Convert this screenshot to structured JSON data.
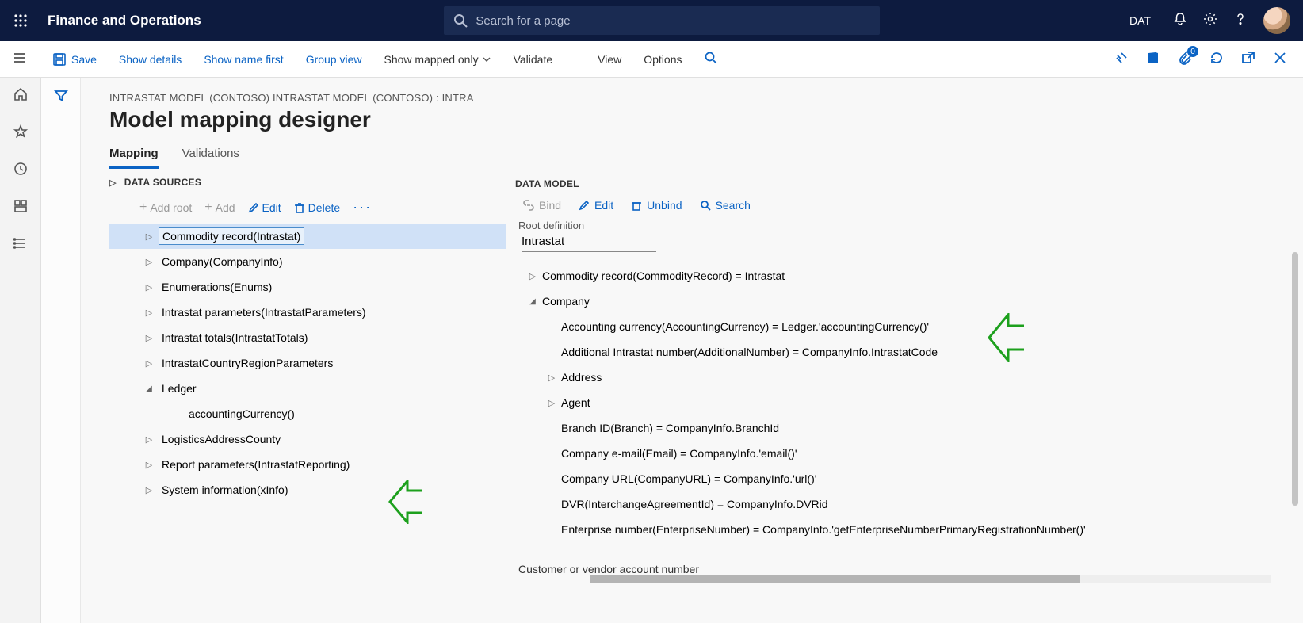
{
  "top": {
    "product": "Finance and Operations",
    "search_placeholder": "Search for a page",
    "company": "DAT"
  },
  "actionbar": {
    "save": "Save",
    "show_details": "Show details",
    "show_name_first": "Show name first",
    "group_view": "Group view",
    "show_mapped_only": "Show mapped only",
    "validate": "Validate",
    "view": "View",
    "options": "Options",
    "badge": "0"
  },
  "breadcrumb": "INTRASTAT MODEL (CONTOSO) INTRASTAT MODEL (CONTOSO) : INTRA",
  "page_title": "Model mapping designer",
  "tabs": {
    "mapping": "Mapping",
    "validations": "Validations"
  },
  "ds": {
    "title": "DATA SOURCES",
    "add_root": "Add root",
    "add": "Add",
    "edit": "Edit",
    "delete": "Delete",
    "items": [
      {
        "label": "Commodity record(Intrastat)",
        "expandable": true,
        "selected": true
      },
      {
        "label": "Company(CompanyInfo)",
        "expandable": true
      },
      {
        "label": "Enumerations(Enums)",
        "expandable": true
      },
      {
        "label": "Intrastat parameters(IntrastatParameters)",
        "expandable": true
      },
      {
        "label": "Intrastat totals(IntrastatTotals)",
        "expandable": true
      },
      {
        "label": "IntrastatCountryRegionParameters",
        "expandable": true
      },
      {
        "label": "Ledger",
        "expandable": true,
        "expanded": true,
        "children": [
          {
            "label": "accountingCurrency()"
          }
        ]
      },
      {
        "label": "LogisticsAddressCounty",
        "expandable": true
      },
      {
        "label": "Report parameters(IntrastatReporting)",
        "expandable": true
      },
      {
        "label": "System information(xInfo)",
        "expandable": true
      }
    ]
  },
  "dm": {
    "title": "DATA MODEL",
    "bind": "Bind",
    "edit": "Edit",
    "unbind": "Unbind",
    "search": "Search",
    "root_label": "Root definition",
    "root_value": "Intrastat",
    "rows": [
      {
        "l": 0,
        "arrow": "right",
        "txt": "Commodity record(CommodityRecord) = Intrastat"
      },
      {
        "l": 0,
        "arrow": "down",
        "txt": "Company"
      },
      {
        "l": 1,
        "arrow": "",
        "txt": "Accounting currency(AccountingCurrency) = Ledger.'accountingCurrency()'"
      },
      {
        "l": 1,
        "arrow": "",
        "txt": "Additional Intrastat number(AdditionalNumber) = CompanyInfo.IntrastatCode"
      },
      {
        "l": 1,
        "arrow": "right",
        "txt": "Address"
      },
      {
        "l": 1,
        "arrow": "right",
        "txt": "Agent"
      },
      {
        "l": 1,
        "arrow": "",
        "txt": "Branch ID(Branch) = CompanyInfo.BranchId"
      },
      {
        "l": 1,
        "arrow": "",
        "txt": "Company e-mail(Email) = CompanyInfo.'email()'"
      },
      {
        "l": 1,
        "arrow": "",
        "txt": "Company URL(CompanyURL) = CompanyInfo.'url()'"
      },
      {
        "l": 1,
        "arrow": "",
        "txt": "DVR(InterchangeAgreementId) = CompanyInfo.DVRid"
      },
      {
        "l": 1,
        "arrow": "",
        "txt": "Enterprise number(EnterpriseNumber) = CompanyInfo.'getEnterpriseNumberPrimaryRegistrationNumber()'"
      }
    ],
    "footer": "Customer or vendor account number"
  }
}
